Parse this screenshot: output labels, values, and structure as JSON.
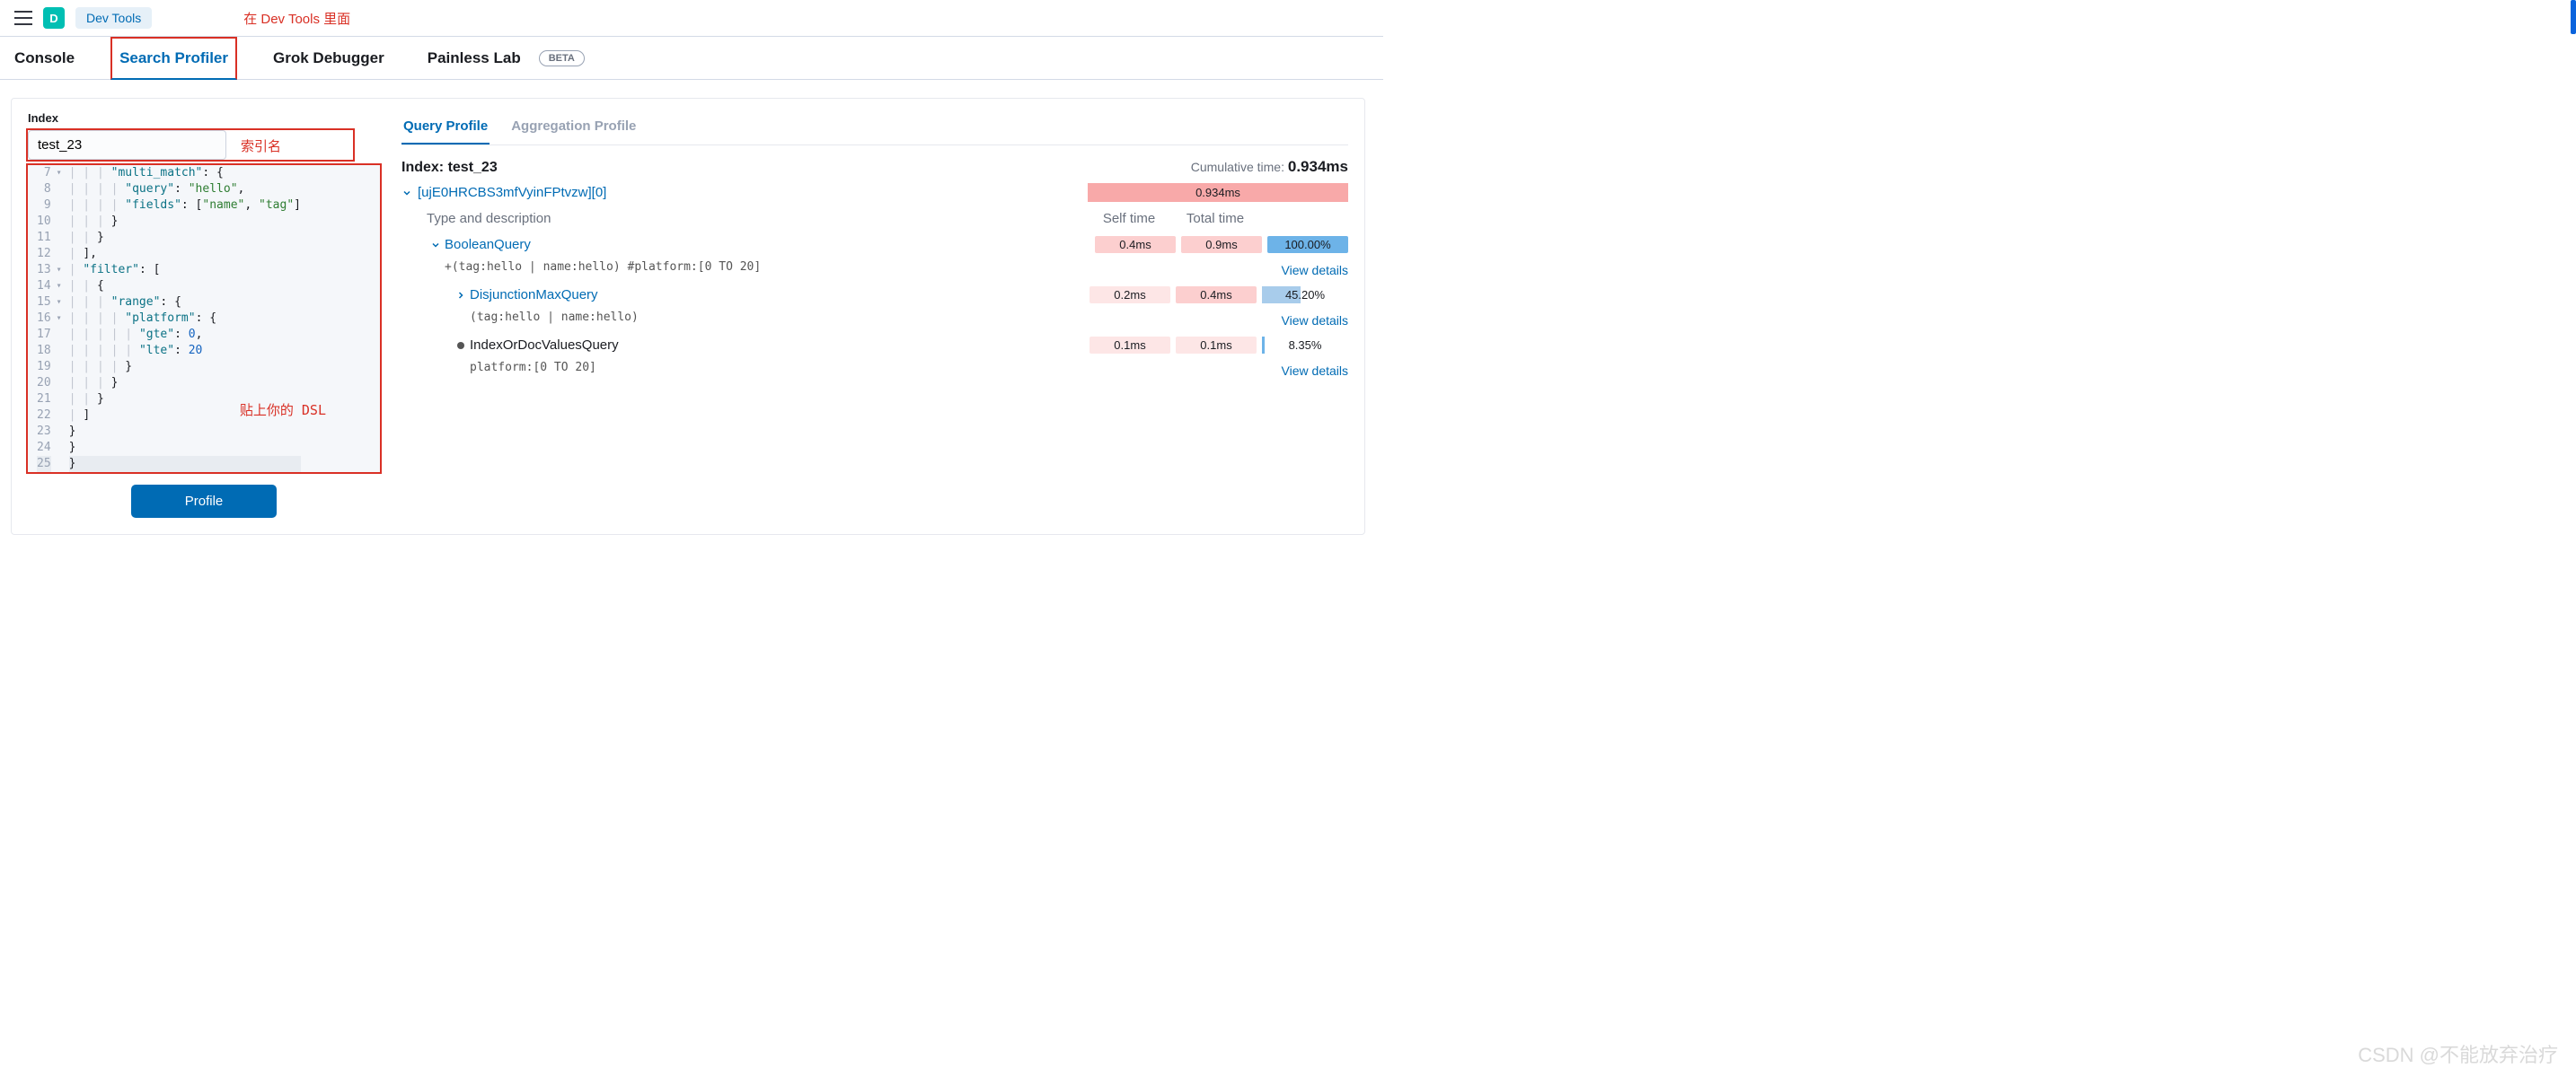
{
  "header": {
    "avatar_letter": "D",
    "breadcrumb": "Dev Tools",
    "annotation_top": "在 Dev Tools 里面"
  },
  "tabs": {
    "console": "Console",
    "search_profiler": "Search Profiler",
    "grok_debugger": "Grok Debugger",
    "painless_lab": "Painless Lab",
    "beta": "BETA"
  },
  "left": {
    "index_label": "Index",
    "index_value": "test_23",
    "annotation_index": "索引名",
    "annotation_dsl": "贴上你的 DSL",
    "profile_button": "Profile",
    "code_lines": [
      {
        "n": "7",
        "fold": "▾",
        "t": "      \"multi_match\": {"
      },
      {
        "n": "8",
        "fold": "",
        "t": "        \"query\": \"hello\","
      },
      {
        "n": "9",
        "fold": "",
        "t": "        \"fields\": [\"name\", \"tag\"]"
      },
      {
        "n": "10",
        "fold": "",
        "t": "      }"
      },
      {
        "n": "11",
        "fold": "",
        "t": "    }"
      },
      {
        "n": "12",
        "fold": "",
        "t": "  ],"
      },
      {
        "n": "13",
        "fold": "▾",
        "t": "  \"filter\": ["
      },
      {
        "n": "14",
        "fold": "▾",
        "t": "    {"
      },
      {
        "n": "15",
        "fold": "▾",
        "t": "      \"range\": {"
      },
      {
        "n": "16",
        "fold": "▾",
        "t": "        \"platform\": {"
      },
      {
        "n": "17",
        "fold": "",
        "t": "          \"gte\": 0,"
      },
      {
        "n": "18",
        "fold": "",
        "t": "          \"lte\": 20"
      },
      {
        "n": "19",
        "fold": "",
        "t": "        }"
      },
      {
        "n": "20",
        "fold": "",
        "t": "      }"
      },
      {
        "n": "21",
        "fold": "",
        "t": "    }"
      },
      {
        "n": "22",
        "fold": "",
        "t": "  ]"
      },
      {
        "n": "23",
        "fold": "",
        "t": " }"
      },
      {
        "n": "24",
        "fold": "",
        "t": "}"
      },
      {
        "n": "25",
        "fold": "",
        "t": "}"
      }
    ]
  },
  "right": {
    "subtabs": {
      "query": "Query Profile",
      "agg": "Aggregation Profile"
    },
    "index_title_prefix": "Index: ",
    "index_title_value": "test_23",
    "cumulative_label": "Cumulative time: ",
    "cumulative_value": "0.934ms",
    "shard_id": "[ujE0HRCBS3mfVyinFPtvzw][0]",
    "shard_bar_value": "0.934ms",
    "th_type": "Type and description",
    "th_self": "Self time",
    "th_total": "Total time",
    "view_details": "View details",
    "rows": [
      {
        "indent": 1,
        "expand": "down",
        "name": "BooleanQuery",
        "desc": "+(tag:hello | name:hello) #platform:[0 TO 20]",
        "self": "0.4ms",
        "self_cls": "pill-pink",
        "total": "0.9ms",
        "total_cls": "pill-pink",
        "pct": "100.00%",
        "pct_type": "full"
      },
      {
        "indent": 2,
        "expand": "right",
        "name": "DisjunctionMaxQuery",
        "desc": "(tag:hello | name:hello)",
        "self": "0.2ms",
        "self_cls": "pill-pinkl",
        "total": "0.4ms",
        "total_cls": "pill-pink",
        "pct": "45.20%",
        "pct_type": "bar",
        "pct_w": 45
      },
      {
        "indent": 2,
        "expand": "dot",
        "name": "IndexOrDocValuesQuery",
        "desc": "platform:[0 TO 20]",
        "self": "0.1ms",
        "self_cls": "pill-pinkl",
        "total": "0.1ms",
        "total_cls": "pill-pinkl",
        "pct": "8.35%",
        "pct_type": "line"
      }
    ]
  },
  "watermark": "CSDN @不能放弃治疗"
}
